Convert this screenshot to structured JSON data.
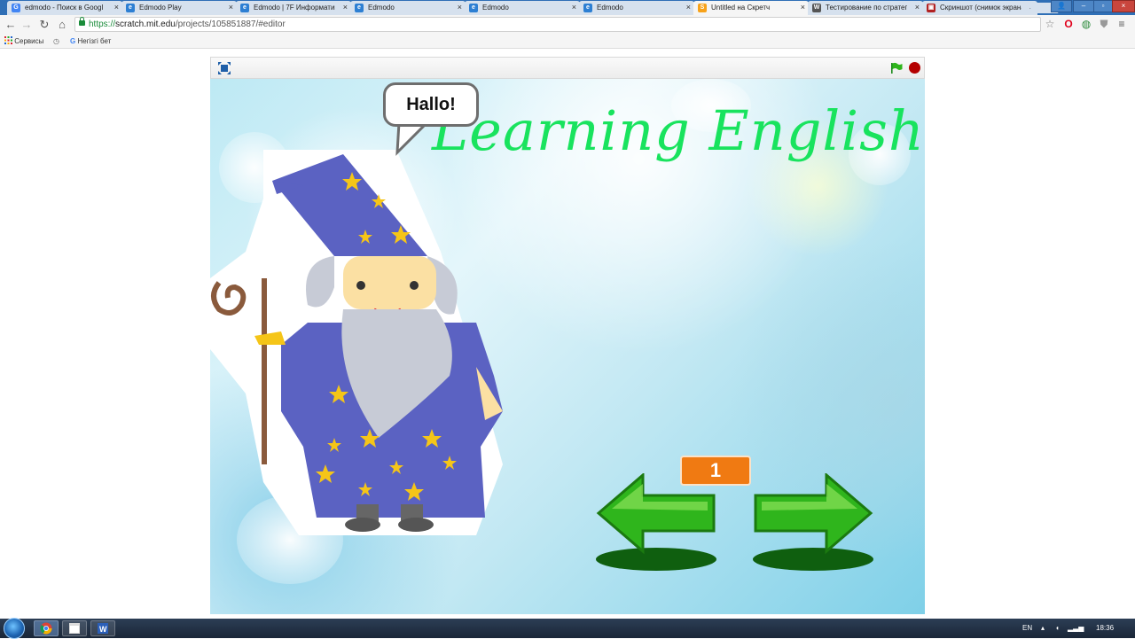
{
  "browser": {
    "tabs": [
      {
        "label": "edmodo - Поиск в Googl",
        "icon": "google-icon",
        "icon_glyph": "G",
        "icon_color": "#4285f4",
        "active": false
      },
      {
        "label": "Edmodo Play",
        "icon": "edmodo-icon",
        "icon_glyph": "e",
        "icon_color": "#2d7fd3",
        "active": false
      },
      {
        "label": "Edmodo | 7F Информатика",
        "icon": "edmodo-icon",
        "icon_glyph": "e",
        "icon_color": "#2d7fd3",
        "active": false
      },
      {
        "label": "Edmodo",
        "icon": "edmodo-icon",
        "icon_glyph": "e",
        "icon_color": "#2d7fd3",
        "active": false
      },
      {
        "label": "Edmodo",
        "icon": "edmodo-icon",
        "icon_glyph": "e",
        "icon_color": "#2d7fd3",
        "active": false
      },
      {
        "label": "Edmodo",
        "icon": "edmodo-icon",
        "icon_glyph": "e",
        "icon_color": "#2d7fd3",
        "active": false
      },
      {
        "label": "Untitled на Скретч",
        "icon": "scratch-icon",
        "icon_glyph": "S",
        "icon_color": "#f7a21a",
        "active": true
      },
      {
        "label": "Тестирование по стратег",
        "icon": "wikipedia-icon",
        "icon_glyph": "W",
        "icon_color": "#555555",
        "active": false
      },
      {
        "label": "Скриншот (снимок экрана",
        "icon": "screenshot-icon",
        "icon_glyph": "▣",
        "icon_color": "#b22222",
        "active": false
      }
    ],
    "close_glyph": "×",
    "window_controls": {
      "user": "👤",
      "minimize": "–",
      "maximize": "▫",
      "close": "×"
    },
    "nav": {
      "back": "←",
      "forward": "→",
      "reload": "↻",
      "home": "⌂"
    },
    "url": {
      "scheme": "https://",
      "host": "scratch.mit.edu",
      "path": "/projects/105851887/#editor"
    },
    "toolbar_icons": {
      "star": "☆",
      "opera": "O",
      "globe": "◍",
      "shield": "⛊",
      "menu": "≡"
    },
    "bookmarks": [
      {
        "label": "Сервисы",
        "icon": "apps-icon"
      },
      {
        "label": "",
        "icon": "history-icon"
      },
      {
        "label": "Негізгі бет",
        "icon": "google-icon"
      }
    ]
  },
  "player": {
    "stage_title": "Learning English",
    "speech": "Hallo!",
    "counter": "1",
    "colors": {
      "title": "#19e35e",
      "counter": "#f07a12",
      "arrow": "#2fb51c",
      "stop": "#b40000"
    }
  },
  "taskbar": {
    "lang": "EN",
    "time": "18:36"
  }
}
